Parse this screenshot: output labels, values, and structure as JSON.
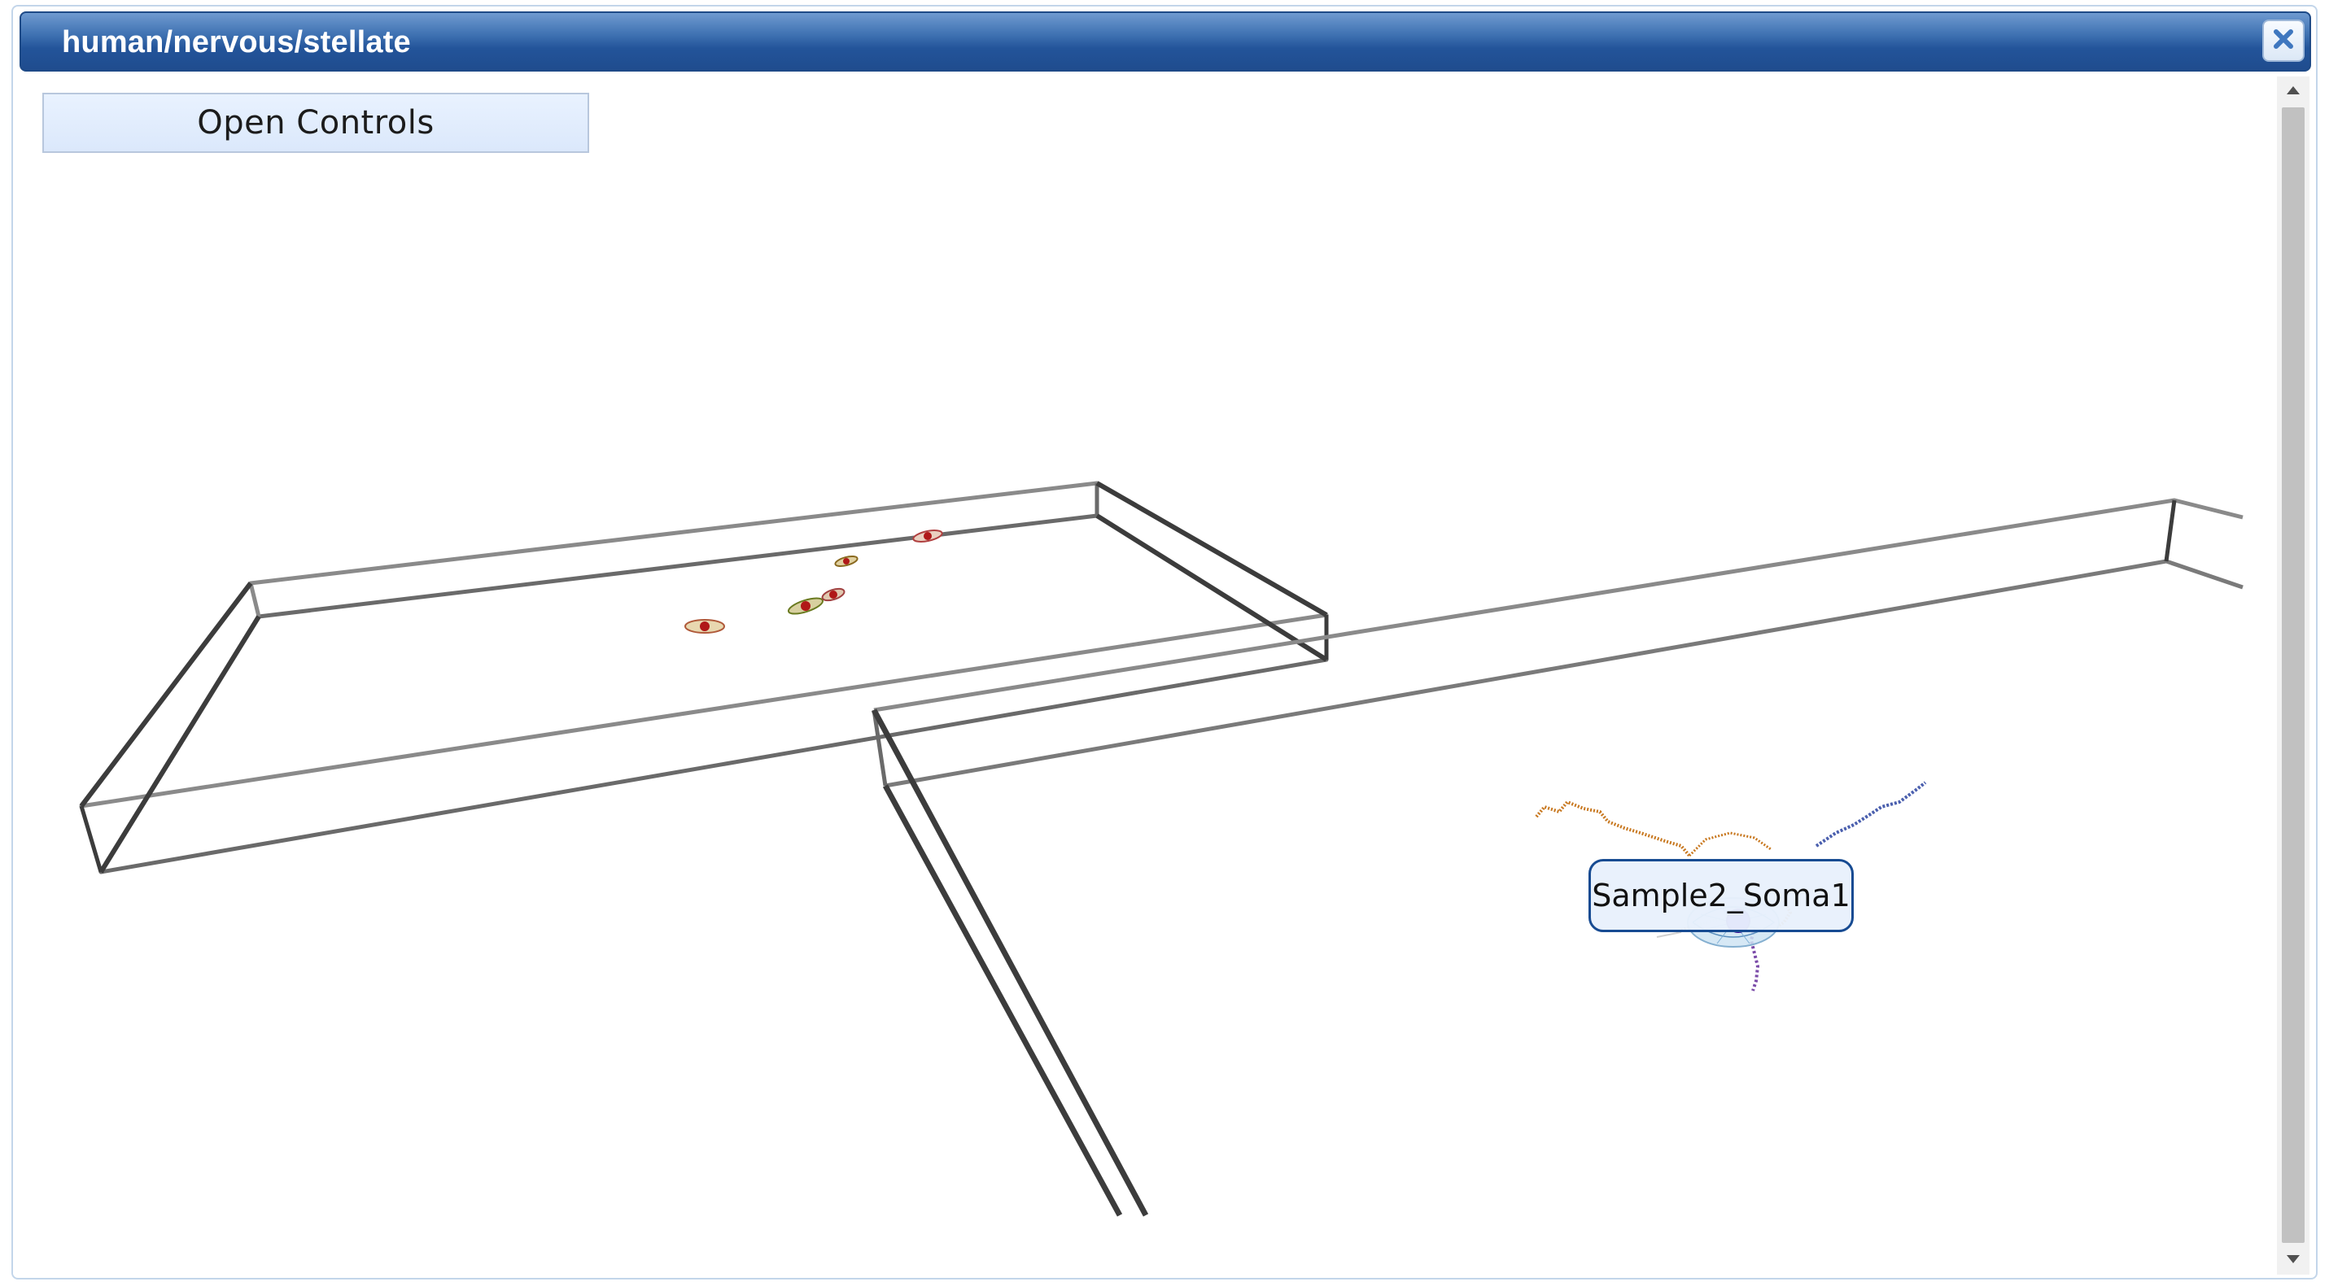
{
  "window": {
    "title": "human/nervous/stellate",
    "close_icon": "close-icon"
  },
  "viewer": {
    "controls_label": "Open Controls",
    "selection_label": "Sample2_Soma1"
  },
  "colors": {
    "titlebar": "#23549a",
    "wireframe": "#4a4a4a",
    "soma": "#6a1fd6",
    "dendrite_orange": "#c87820",
    "dendrite_blue": "#4a5fae",
    "tooltip_border": "#174b92"
  },
  "scrollbar": {
    "up_icon": "scroll-up-arrow-icon",
    "down_icon": "scroll-down-arrow-icon"
  }
}
